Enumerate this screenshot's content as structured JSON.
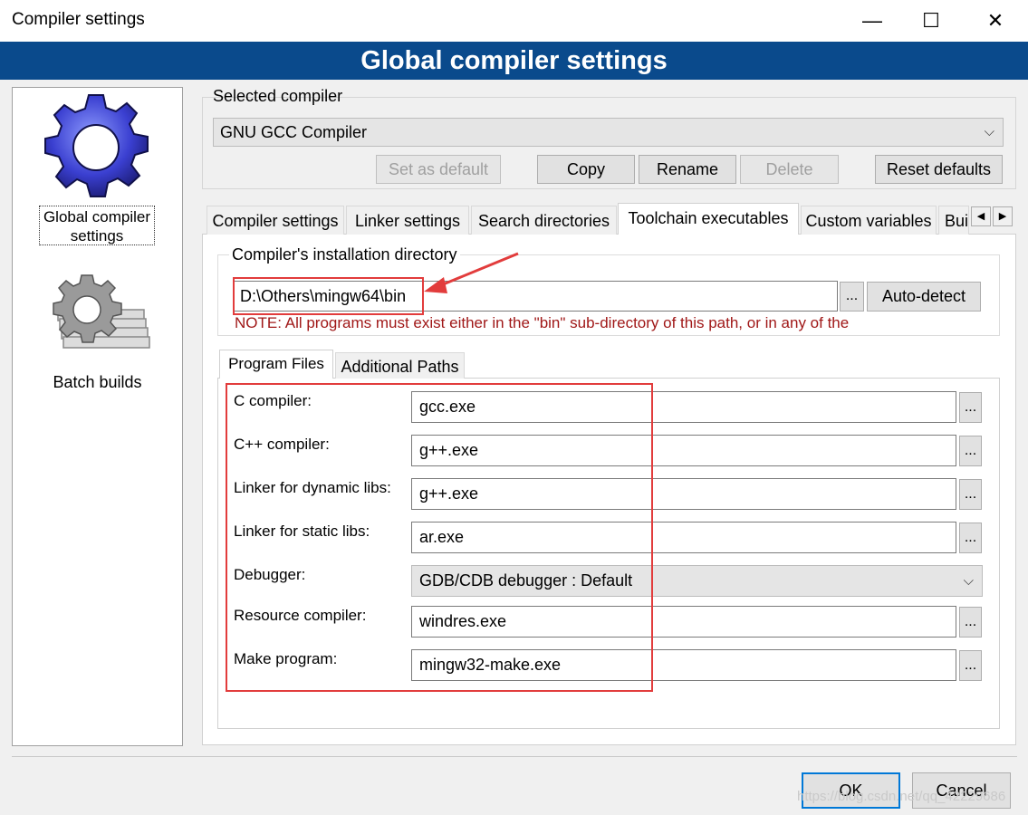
{
  "window": {
    "title": "Compiler settings",
    "minimize": "—",
    "maximize": "☐",
    "close": "✕"
  },
  "banner": "Global compiler settings",
  "sidebar": {
    "items": [
      {
        "label": "Global compiler settings",
        "icon": "gear-blue-icon"
      },
      {
        "label": "Batch builds",
        "icon": "gear-gray-icon"
      }
    ]
  },
  "selected_compiler": {
    "group_label": "Selected compiler",
    "value": "GNU GCC Compiler",
    "buttons": {
      "set_default": "Set as default",
      "copy": "Copy",
      "rename": "Rename",
      "delete": "Delete",
      "reset": "Reset defaults"
    }
  },
  "tabs": [
    "Compiler settings",
    "Linker settings",
    "Search directories",
    "Toolchain executables",
    "Custom variables",
    "Bui"
  ],
  "active_tab": "Toolchain executables",
  "install_dir": {
    "label": "Compiler's installation directory",
    "value": "D:\\Others\\mingw64\\bin",
    "browse": "...",
    "autodetect": "Auto-detect",
    "note": "NOTE: All programs must exist either in the \"bin\" sub-directory of this path, or in any of the"
  },
  "inner_tabs": [
    "Program Files",
    "Additional Paths"
  ],
  "programs": {
    "c_compiler": {
      "label": "C compiler:",
      "value": "gcc.exe"
    },
    "cpp_compiler": {
      "label": "C++ compiler:",
      "value": "g++.exe"
    },
    "linker_dynamic": {
      "label": "Linker for dynamic libs:",
      "value": "g++.exe"
    },
    "linker_static": {
      "label": "Linker for static libs:",
      "value": "ar.exe"
    },
    "debugger": {
      "label": "Debugger:",
      "value": "GDB/CDB debugger : Default"
    },
    "resource_compiler": {
      "label": "Resource compiler:",
      "value": "windres.exe"
    },
    "make_program": {
      "label": "Make program:",
      "value": "mingw32-make.exe"
    },
    "browse": "..."
  },
  "footer": {
    "ok": "OK",
    "cancel": "Cancel"
  },
  "watermark": "https://blog.csdn.net/qq_42229686",
  "colors": {
    "banner": "#0a4a8c",
    "annotation": "#e23c3c",
    "note_text": "#a01818"
  }
}
